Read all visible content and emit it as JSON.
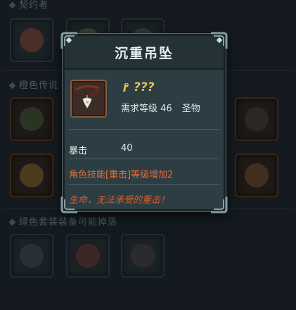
{
  "background": {
    "sections": [
      {
        "label": "契约者"
      },
      {
        "label": "橙色传说"
      },
      {
        "label": "绿色套装装备可能掉落"
      }
    ]
  },
  "tooltip": {
    "title": "沉重吊坠",
    "item_name": "???",
    "item_icon": "pendant-icon",
    "rarity_icon": "gold-key-icon",
    "required_level_label": "需求等级 46",
    "category": "圣物",
    "stat": {
      "label": "暴击",
      "value": "40"
    },
    "effect": "角色技能[重击]等级增加2",
    "flavor": "生命，无法承受的重击！"
  },
  "colors": {
    "panel": "#2c3d43",
    "gold": "#e3c14a",
    "orange": "#e76b36",
    "frame_orange": "#8a5a3a"
  }
}
